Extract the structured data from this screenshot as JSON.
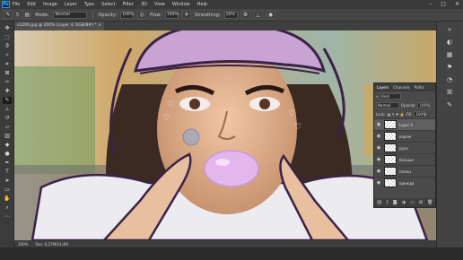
{
  "app": {
    "logo": "Ps"
  },
  "menu": [
    "File",
    "Edit",
    "Image",
    "Layer",
    "Type",
    "Select",
    "Filter",
    "3D",
    "View",
    "Window",
    "Help"
  ],
  "window_controls": [
    "–",
    "□",
    "✕"
  ],
  "options": {
    "brush_size": "5",
    "mode_label": "Mode:",
    "mode_value": "Normal",
    "opacity_label": "Opacity:",
    "opacity_value": "100%",
    "flow_label": "Flow:",
    "flow_value": "100%",
    "smoothing_label": "Smoothing:",
    "smoothing_value": "10%"
  },
  "document": {
    "tab_title": "s1200.jpg @ 200% (Layer 4, RGB/8#) *",
    "close": "×"
  },
  "layers_panel": {
    "tabs": [
      "Layers",
      "Channels",
      "Paths"
    ],
    "kind_label": "Kind",
    "blend": "Normal",
    "opacity_label": "Opacity:",
    "opacity_value": "100%",
    "lock_label": "Lock:",
    "fill_label": "Fill:",
    "fill_value": "100%",
    "layers": [
      {
        "name": "Layer 4",
        "selected": true
      },
      {
        "name": "вареж",
        "selected": false
      },
      {
        "name": "рука",
        "selected": false
      },
      {
        "name": "больше",
        "selected": false
      },
      {
        "name": "палец",
        "selected": false
      },
      {
        "name": "одежда",
        "selected": false
      }
    ],
    "footer_icons": [
      "link-icon",
      "fx-icon",
      "mask-icon",
      "adjustment-icon",
      "folder-icon",
      "new-layer-icon",
      "trash-icon"
    ]
  },
  "status": {
    "zoom": "200%",
    "doc": "Doc: 6,27M/14,4M"
  },
  "colors": {
    "accent": "#2f8fe0",
    "hat": "#c9a3d4",
    "outline": "#3a2248",
    "gum": "#e3b6ee"
  }
}
